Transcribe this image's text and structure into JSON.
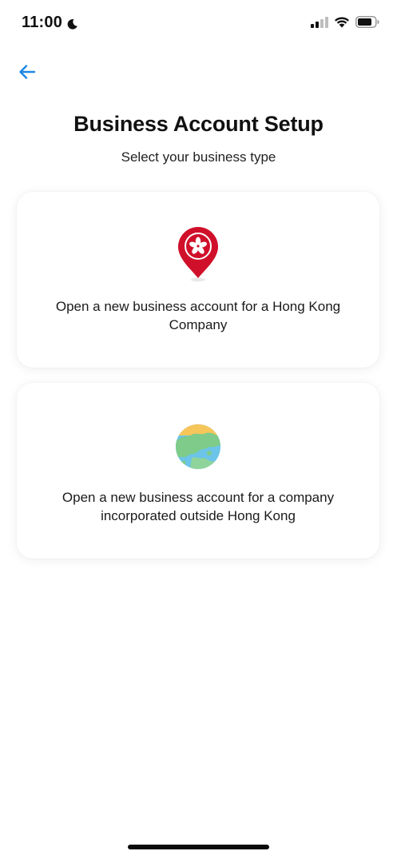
{
  "status_bar": {
    "time": "11:00",
    "icons": [
      "moon-icon",
      "cellular-signal-icon",
      "wifi-icon",
      "battery-icon"
    ]
  },
  "navigation": {
    "back_icon": "arrow-left-icon"
  },
  "header": {
    "title": "Business Account Setup",
    "subtitle": "Select your business type"
  },
  "options": [
    {
      "icon": "hong-kong-location-pin-icon",
      "label": "Open a new business account for a Hong Kong Company"
    },
    {
      "icon": "globe-icon",
      "label": "Open a new business account for a company incorporated outside Hong Kong"
    }
  ],
  "colors": {
    "accent": "#1e88e5",
    "hk_red": "#d0102a",
    "globe_water": "#6cc4e8",
    "globe_land": "#7ecb8a",
    "globe_sun": "#f6c65b"
  }
}
